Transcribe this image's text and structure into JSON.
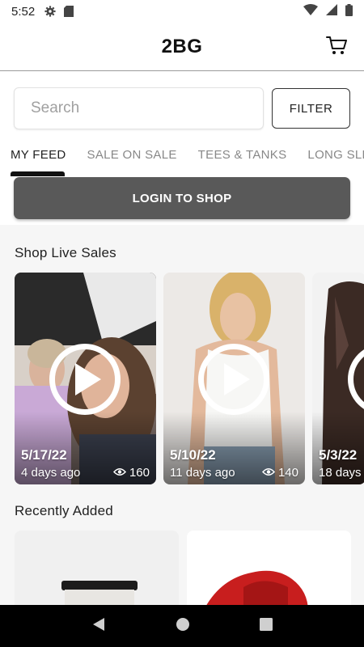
{
  "status_bar": {
    "time": "5:52",
    "icons": [
      "gear-icon",
      "sd-card-icon",
      "wifi-icon",
      "signal-icon",
      "battery-icon"
    ]
  },
  "app_bar": {
    "title": "2BG",
    "cart_icon": "cart-icon"
  },
  "search": {
    "placeholder": "Search",
    "filter_label": "FILTER"
  },
  "tabs": [
    {
      "label": "MY FEED",
      "active": true
    },
    {
      "label": "SALE ON SALE",
      "active": false
    },
    {
      "label": "TEES & TANKS",
      "active": false
    },
    {
      "label": "LONG SLE",
      "active": false
    }
  ],
  "login_button": "LOGIN TO SHOP",
  "live_sales": {
    "title": "Shop Live Sales",
    "cards": [
      {
        "date": "5/17/22",
        "ago": "4 days ago",
        "views": "160"
      },
      {
        "date": "5/10/22",
        "ago": "11 days ago",
        "views": "140"
      },
      {
        "date": "5/3/22",
        "ago": "18 days",
        "views": ""
      }
    ]
  },
  "recently_added": {
    "title": "Recently Added"
  },
  "nav": {
    "back": "back-icon",
    "home": "home-icon",
    "recents": "recents-icon"
  },
  "colors": {
    "login_bg": "#595959",
    "nav_bg": "#000000",
    "accent_dark": "#111111"
  }
}
